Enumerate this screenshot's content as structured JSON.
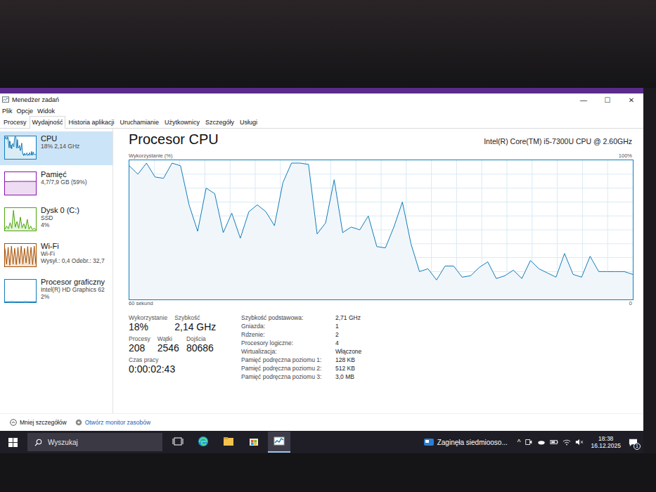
{
  "window": {
    "title": "Menedżer zadań",
    "controls": [
      "—",
      "☐",
      "✕"
    ]
  },
  "menu": [
    "Plik",
    "Opcje",
    "Widok"
  ],
  "tabs": [
    {
      "label": "Procesy",
      "selected": false
    },
    {
      "label": "Wydajność",
      "selected": true
    },
    {
      "label": "Historia aplikacji",
      "selected": false
    },
    {
      "label": "Uruchamianie",
      "selected": false
    },
    {
      "label": "Użytkownicy",
      "selected": false
    },
    {
      "label": "Szczegóły",
      "selected": false
    },
    {
      "label": "Usługi",
      "selected": false
    }
  ],
  "sidebar": {
    "items": [
      {
        "name": "CPU",
        "lines": [
          "18% 2,14 GHz"
        ],
        "selected": true,
        "color": "#117dbb",
        "values": [
          96,
          90,
          98,
          88,
          87,
          98,
          96,
          68,
          49,
          80,
          76,
          48,
          62,
          44,
          63,
          68,
          63,
          53,
          84,
          98,
          98,
          97,
          47,
          55,
          86,
          48,
          52,
          50,
          60,
          38,
          37,
          52,
          70,
          40,
          20,
          22,
          14,
          24,
          24,
          16,
          17,
          23,
          27,
          15,
          17,
          21,
          15,
          28,
          22,
          19,
          16,
          33,
          18,
          16,
          31,
          20,
          20,
          20,
          20,
          18
        ]
      },
      {
        "name": "Pamięć",
        "lines": [
          "4,7/7,9 GB (59%)"
        ],
        "selected": false,
        "color": "#8b12ae",
        "values": [
          58,
          58,
          59,
          59,
          59,
          59,
          59,
          59,
          59,
          59
        ]
      },
      {
        "name": "Dysk 0 (C:)",
        "lines": [
          "SSD",
          "4%"
        ],
        "selected": false,
        "color": "#4da60c",
        "values": [
          5,
          20,
          8,
          35,
          10,
          90,
          15,
          40,
          10,
          60,
          12,
          30,
          8,
          50,
          6,
          20,
          4,
          10,
          4
        ]
      },
      {
        "name": "Wi-Fi",
        "lines": [
          "Wi-Fi",
          "Wysył.: 0,4 Odebr.: 32,7"
        ],
        "selected": false,
        "color": "#a74f01",
        "values": [
          80,
          10,
          85,
          5,
          90,
          10,
          80,
          8,
          85,
          12,
          90,
          10,
          80,
          15,
          88,
          10,
          85,
          8,
          90,
          10
        ]
      },
      {
        "name": "Procesor graficzny",
        "lines": [
          "Intel(R) HD Graphics 62",
          "2%"
        ],
        "selected": false,
        "color": "#117dbb",
        "values": [
          2,
          2,
          3,
          2,
          2,
          2,
          3,
          2,
          2,
          2
        ]
      }
    ]
  },
  "main": {
    "title": "Procesor CPU",
    "model": "Intel(R) Core(TM) i5-7300U CPU @ 2.60GHz",
    "chart": {
      "axis_label": "Wykorzystanie (%)",
      "max_label": "100%",
      "time_label": "60 sekund",
      "min_label": "0",
      "max": 100,
      "values": [
        96,
        90,
        98,
        88,
        87,
        98,
        96,
        68,
        49,
        80,
        76,
        48,
        62,
        44,
        63,
        68,
        63,
        53,
        84,
        98,
        98,
        97,
        47,
        55,
        86,
        48,
        52,
        50,
        60,
        38,
        37,
        52,
        70,
        40,
        20,
        22,
        14,
        24,
        24,
        16,
        17,
        23,
        27,
        15,
        17,
        21,
        15,
        28,
        22,
        19,
        16,
        33,
        18,
        16,
        31,
        20,
        20,
        20,
        20,
        18
      ]
    },
    "stats": [
      [
        {
          "label": "Wykorzystanie",
          "value": "18%"
        },
        {
          "label": "Szybkość",
          "value": "2,14 GHz"
        }
      ],
      [
        {
          "label": "Procesy",
          "value": "208"
        },
        {
          "label": "Wątki",
          "value": "2546"
        },
        {
          "label": "Dojścia",
          "value": "80686"
        }
      ],
      [
        {
          "label": "Czas pracy",
          "value": "0:00:02:43"
        }
      ]
    ],
    "details": [
      {
        "label": "Szybkość podstawowa:",
        "value": "2,71 GHz"
      },
      {
        "label": "Gniazda:",
        "value": "1"
      },
      {
        "label": "Rdzenie:",
        "value": "2"
      },
      {
        "label": "Procesory logiczne:",
        "value": "4"
      },
      {
        "label": "Wirtualizacja:",
        "value": "Włączone"
      },
      {
        "label": "Pamięć podręczna poziomu 1:",
        "value": "128 KB"
      },
      {
        "label": "Pamięć podręczna poziomu 2:",
        "value": "512 KB"
      },
      {
        "label": "Pamięć podręczna poziomu 3:",
        "value": "3,0 MB"
      }
    ]
  },
  "footer": {
    "less": "Mniej szczegółów",
    "monitor": "Otwórz monitor zasobów"
  },
  "taskbar": {
    "search_placeholder": "Wyszukaj",
    "apps": [
      {
        "kind": "taskview",
        "selected": false
      },
      {
        "kind": "edge",
        "selected": false
      },
      {
        "kind": "explorer",
        "selected": false
      },
      {
        "kind": "store",
        "selected": false
      },
      {
        "kind": "taskmgr",
        "selected": true
      }
    ],
    "news": "Zaginęła siedmiooso...",
    "chevron": "^",
    "time": "18:38",
    "date": "16.12.2025",
    "notifications": "1"
  }
}
